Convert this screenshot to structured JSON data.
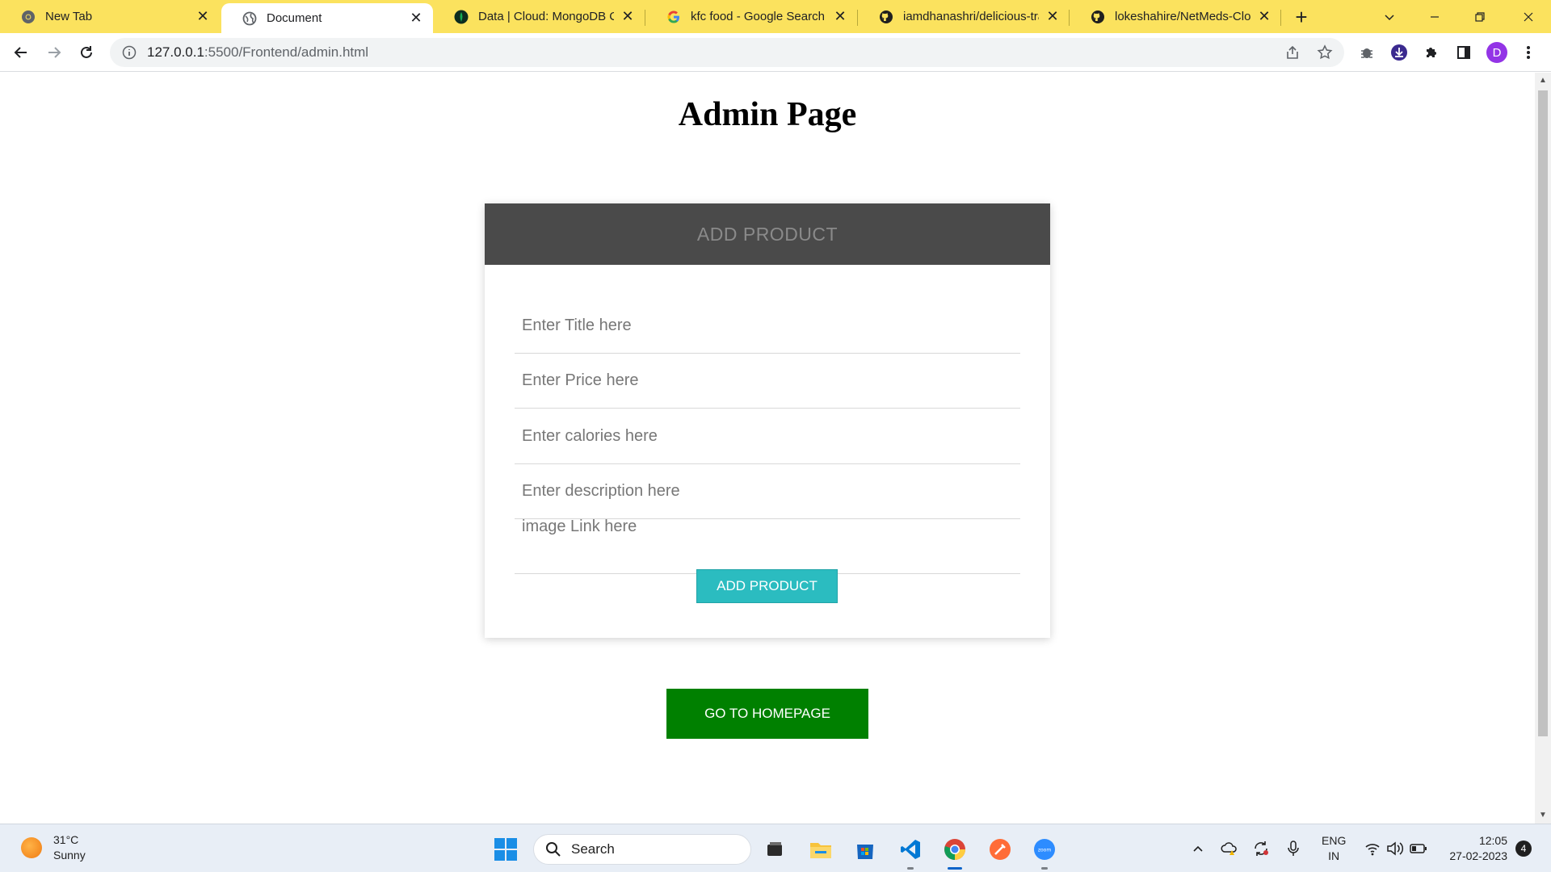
{
  "browser": {
    "tabs": [
      {
        "title": "New Tab",
        "icon": "chrome-icon",
        "active": false
      },
      {
        "title": "Document",
        "icon": "globe-icon",
        "active": true
      },
      {
        "title": "Data | Cloud: MongoDB Clo",
        "icon": "mongodb-leaf-icon",
        "active": false
      },
      {
        "title": "kfc food - Google Search",
        "icon": "google-icon",
        "active": false
      },
      {
        "title": "iamdhanashri/delicious-tra",
        "icon": "github-icon",
        "active": false
      },
      {
        "title": "lokeshahire/NetMeds-Clon",
        "icon": "github-icon",
        "active": false
      }
    ],
    "url_host": "127.0.0.1",
    "url_rest": ":5500/Frontend/admin.html",
    "profile_initial": "D",
    "theme_color": "#fbe25e"
  },
  "page": {
    "title": "Admin Page",
    "form": {
      "header": "ADD PRODUCT",
      "fields": {
        "title_placeholder": "Enter Title here",
        "price_placeholder": "Enter Price here",
        "calories_placeholder": "Enter calories here",
        "description_placeholder": "Enter description here",
        "image_placeholder": "image Link here"
      },
      "submit_label": "ADD PRODUCT",
      "submit_color": "#2bbcc0",
      "header_color": "#4a4a4a"
    },
    "home_button_label": "GO TO HOMEPAGE",
    "home_button_color": "#008000"
  },
  "taskbar": {
    "weather_temp": "31°C",
    "weather_desc": "Sunny",
    "search_label": "Search",
    "apps": [
      "file-explorer-icon",
      "task-view-icon",
      "folder-icon",
      "microsoft-store-icon",
      "vscode-icon",
      "chrome-icon",
      "postman-icon",
      "zoom-icon"
    ],
    "lang_line1": "ENG",
    "lang_line2": "IN",
    "time": "12:05",
    "date": "27-02-2023",
    "notification_count": "4"
  }
}
